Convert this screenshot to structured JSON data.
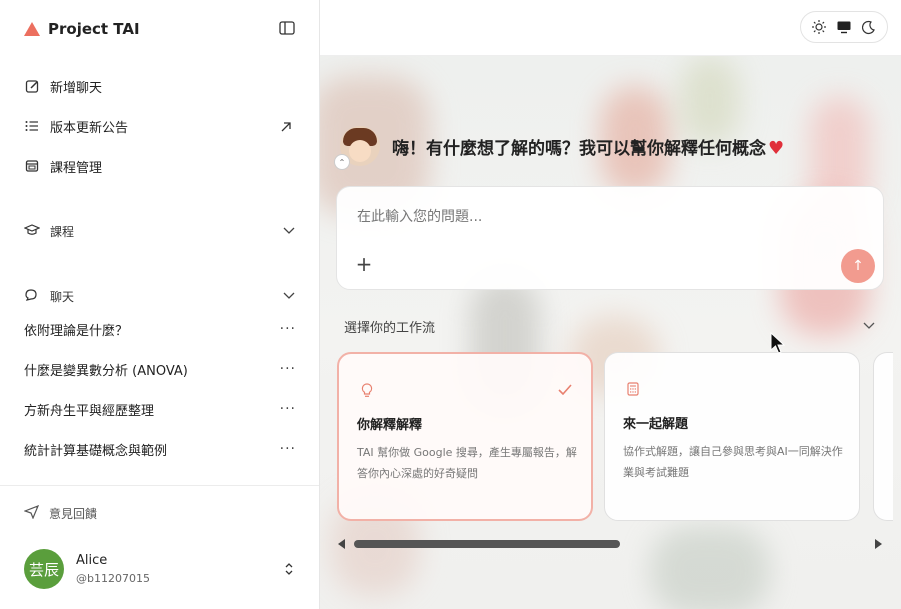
{
  "app": {
    "title": "Project TAI"
  },
  "sidebar": {
    "nav": [
      {
        "label": "新增聊天",
        "icon": "edit-icon"
      },
      {
        "label": "版本更新公告",
        "icon": "list-icon"
      },
      {
        "label": "課程管理",
        "icon": "course-manage-icon"
      }
    ],
    "courses_label": "課程",
    "chat_label": "聊天",
    "chats": [
      "依附理論是什麼？",
      "什麼是變異數分析 (ANOVA)",
      "方新舟生平與經歷整理",
      "統計計算基礎概念與範例"
    ],
    "chat_more": "···",
    "feedback_label": "意見回饋",
    "user": {
      "avatar_text": "芸辰",
      "name": "Alice",
      "handle": "@b11207015"
    }
  },
  "main": {
    "greeting": "嗨！有什麼想了解的嗎？我可以幫你解釋任何概念",
    "heart": "♥",
    "input_placeholder": "在此輸入您的問題...",
    "plus": "+",
    "send": "↑",
    "workflow_label": "選擇你的工作流",
    "cards": [
      {
        "title": "你解釋解釋",
        "desc": "TAI 幫你做 Google 搜尋，產生專屬報告，解答你內心深處的好奇疑問",
        "selected": true
      },
      {
        "title": "來一起解題",
        "desc": "協作式解題，讓自己參與思考與AI一同解決作業與考試難題",
        "selected": false
      }
    ]
  },
  "colors": {
    "accent": "#ec6f5f",
    "send": "#f29b8f",
    "avatar": "#5a9e3c"
  }
}
